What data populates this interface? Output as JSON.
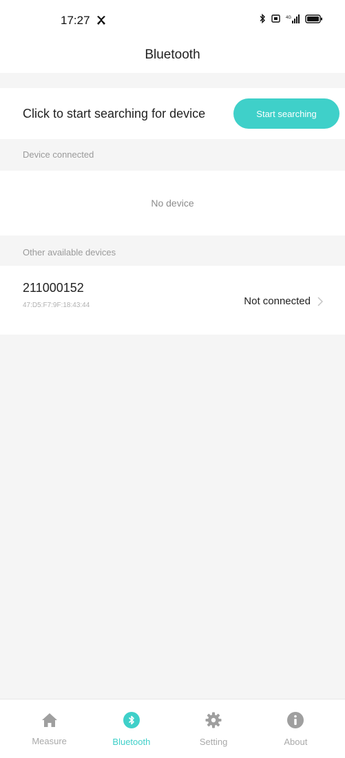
{
  "status_bar": {
    "time": "17:27"
  },
  "header": {
    "title": "Bluetooth"
  },
  "search": {
    "hint": "Click to start searching for device",
    "button_label": "Start searching"
  },
  "sections": {
    "connected_label": "Device connected",
    "no_device": "No device",
    "available_label": "Other available devices"
  },
  "devices": [
    {
      "name": "211000152",
      "mac": "47:D5:F7:9F:18:43:44",
      "status": "Not connected"
    }
  ],
  "tabs": [
    {
      "label": "Measure",
      "icon": "home-icon",
      "active": false
    },
    {
      "label": "Bluetooth",
      "icon": "bluetooth-icon",
      "active": true
    },
    {
      "label": "Setting",
      "icon": "gear-icon",
      "active": false
    },
    {
      "label": "About",
      "icon": "info-icon",
      "active": false
    }
  ],
  "colors": {
    "accent": "#3fd0c9",
    "background": "#f5f5f5",
    "inactive_tab": "#a9a9a9"
  }
}
